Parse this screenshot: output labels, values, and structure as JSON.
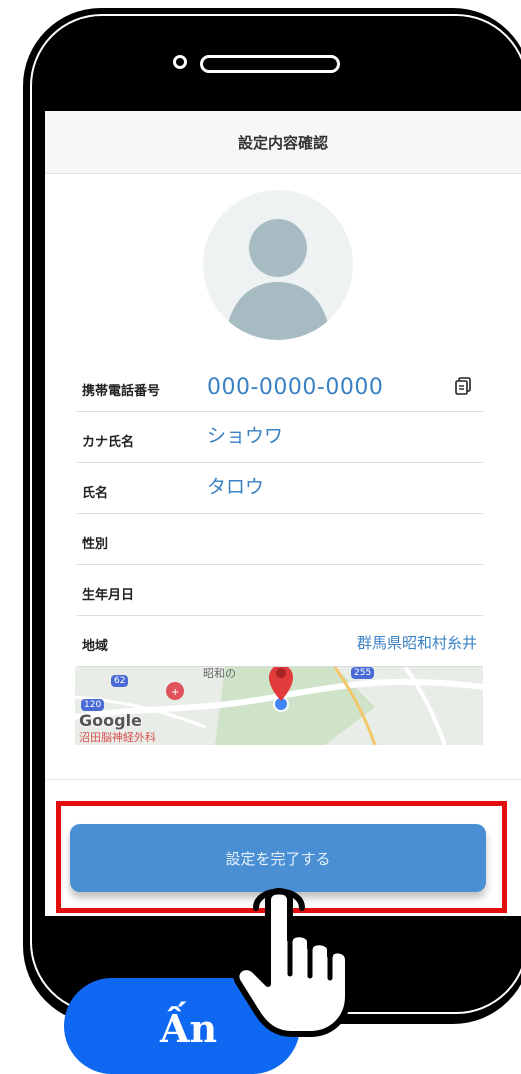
{
  "screen": {
    "title": "設定内容確認",
    "fields": [
      {
        "label": "携帯電話番号",
        "value": "000-0000-0000"
      },
      {
        "label": "カナ氏名",
        "value": "ショウワ"
      },
      {
        "label": "氏名",
        "value": "タロウ"
      },
      {
        "label": "性別",
        "value": ""
      },
      {
        "label": "生年月日",
        "value": ""
      },
      {
        "label": "地域",
        "value": "群馬県昭和村糸井"
      }
    ],
    "map": {
      "labels": [
        "昭和の",
        "沼田脳神経外科"
      ],
      "route_badges": [
        "62",
        "120",
        "255"
      ],
      "google_logo": "Google"
    },
    "complete_button": "設定を完了する"
  },
  "overlay": {
    "press_label": "Ấn",
    "highlight_color": "#e20d0d"
  },
  "colors": {
    "accent_text": "#3b82c4",
    "button": "#4a8fd4",
    "press_pill": "#0f68f2"
  }
}
